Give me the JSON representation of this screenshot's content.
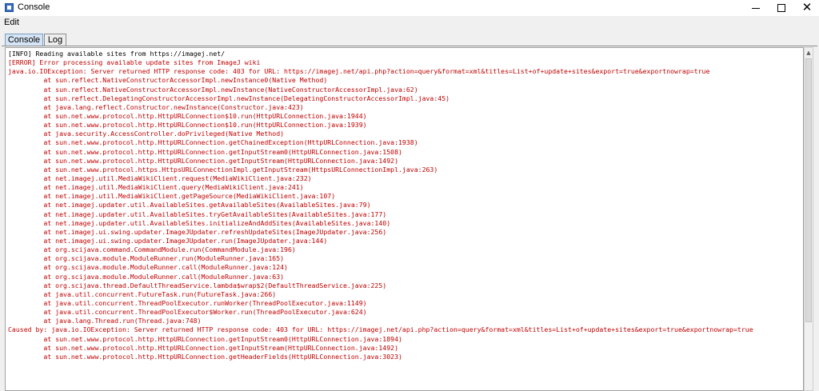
{
  "window": {
    "title": "Console",
    "minimize_icon": "minimize-icon",
    "maximize_icon": "maximize-icon",
    "close_icon": "close-icon",
    "close_glyph": "✕"
  },
  "menu": {
    "items": [
      "Edit"
    ]
  },
  "tabs": [
    {
      "label": "Console",
      "selected": true
    },
    {
      "label": "Log",
      "selected": false
    }
  ],
  "colors": {
    "info": "#000000",
    "error": "#c00000"
  },
  "console": {
    "lines": [
      {
        "text": "[INFO] Reading available sites from https://imagej.net/",
        "level": "info"
      },
      {
        "text": "[ERROR] Error processing available update sites from ImageJ wiki",
        "level": "error"
      },
      {
        "text": "java.io.IOException: Server returned HTTP response code: 403 for URL: https://imagej.net/api.php?action=query&format=xml&titles=List+of+update+sites&export=true&exportnowrap=true",
        "level": "error"
      },
      {
        "text": "\tat sun.reflect.NativeConstructorAccessorImpl.newInstance0(Native Method)",
        "level": "error"
      },
      {
        "text": "\tat sun.reflect.NativeConstructorAccessorImpl.newInstance(NativeConstructorAccessorImpl.java:62)",
        "level": "error"
      },
      {
        "text": "\tat sun.reflect.DelegatingConstructorAccessorImpl.newInstance(DelegatingConstructorAccessorImpl.java:45)",
        "level": "error"
      },
      {
        "text": "\tat java.lang.reflect.Constructor.newInstance(Constructor.java:423)",
        "level": "error"
      },
      {
        "text": "\tat sun.net.www.protocol.http.HttpURLConnection$10.run(HttpURLConnection.java:1944)",
        "level": "error"
      },
      {
        "text": "\tat sun.net.www.protocol.http.HttpURLConnection$10.run(HttpURLConnection.java:1939)",
        "level": "error"
      },
      {
        "text": "\tat java.security.AccessController.doPrivileged(Native Method)",
        "level": "error"
      },
      {
        "text": "\tat sun.net.www.protocol.http.HttpURLConnection.getChainedException(HttpURLConnection.java:1938)",
        "level": "error"
      },
      {
        "text": "\tat sun.net.www.protocol.http.HttpURLConnection.getInputStream0(HttpURLConnection.java:1508)",
        "level": "error"
      },
      {
        "text": "\tat sun.net.www.protocol.http.HttpURLConnection.getInputStream(HttpURLConnection.java:1492)",
        "level": "error"
      },
      {
        "text": "\tat sun.net.www.protocol.https.HttpsURLConnectionImpl.getInputStream(HttpsURLConnectionImpl.java:263)",
        "level": "error"
      },
      {
        "text": "\tat net.imagej.util.MediaWikiClient.request(MediaWikiClient.java:232)",
        "level": "error"
      },
      {
        "text": "\tat net.imagej.util.MediaWikiClient.query(MediaWikiClient.java:241)",
        "level": "error"
      },
      {
        "text": "\tat net.imagej.util.MediaWikiClient.getPageSource(MediaWikiClient.java:107)",
        "level": "error"
      },
      {
        "text": "\tat net.imagej.updater.util.AvailableSites.getAvailableSites(AvailableSites.java:79)",
        "level": "error"
      },
      {
        "text": "\tat net.imagej.updater.util.AvailableSites.tryGetAvailableSites(AvailableSites.java:177)",
        "level": "error"
      },
      {
        "text": "\tat net.imagej.updater.util.AvailableSites.initializeAndAddSites(AvailableSites.java:140)",
        "level": "error"
      },
      {
        "text": "\tat net.imagej.ui.swing.updater.ImageJUpdater.refreshUpdateSites(ImageJUpdater.java:256)",
        "level": "error"
      },
      {
        "text": "\tat net.imagej.ui.swing.updater.ImageJUpdater.run(ImageJUpdater.java:144)",
        "level": "error"
      },
      {
        "text": "\tat org.scijava.command.CommandModule.run(CommandModule.java:196)",
        "level": "error"
      },
      {
        "text": "\tat org.scijava.module.ModuleRunner.run(ModuleRunner.java:165)",
        "level": "error"
      },
      {
        "text": "\tat org.scijava.module.ModuleRunner.call(ModuleRunner.java:124)",
        "level": "error"
      },
      {
        "text": "\tat org.scijava.module.ModuleRunner.call(ModuleRunner.java:63)",
        "level": "error"
      },
      {
        "text": "\tat org.scijava.thread.DefaultThreadService.lambda$wrap$2(DefaultThreadService.java:225)",
        "level": "error"
      },
      {
        "text": "\tat java.util.concurrent.FutureTask.run(FutureTask.java:266)",
        "level": "error"
      },
      {
        "text": "\tat java.util.concurrent.ThreadPoolExecutor.runWorker(ThreadPoolExecutor.java:1149)",
        "level": "error"
      },
      {
        "text": "\tat java.util.concurrent.ThreadPoolExecutor$Worker.run(ThreadPoolExecutor.java:624)",
        "level": "error"
      },
      {
        "text": "\tat java.lang.Thread.run(Thread.java:748)",
        "level": "error"
      },
      {
        "text": "Caused by: java.io.IOException: Server returned HTTP response code: 403 for URL: https://imagej.net/api.php?action=query&format=xml&titles=List+of+update+sites&export=true&exportnowrap=true",
        "level": "error"
      },
      {
        "text": "\tat sun.net.www.protocol.http.HttpURLConnection.getInputStream0(HttpURLConnection.java:1894)",
        "level": "error"
      },
      {
        "text": "\tat sun.net.www.protocol.http.HttpURLConnection.getInputStream(HttpURLConnection.java:1492)",
        "level": "error"
      },
      {
        "text": "\tat sun.net.www.protocol.http.HttpURLConnection.getHeaderFields(HttpURLConnection.java:3023)",
        "level": "error"
      }
    ]
  },
  "scrollbar": {
    "up_icon": "scroll-up-arrow-icon",
    "up_glyph": "▲"
  }
}
